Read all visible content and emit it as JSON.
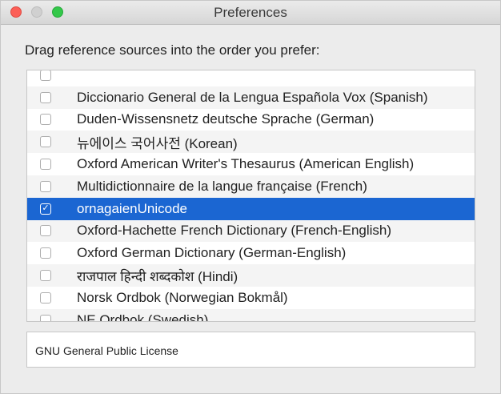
{
  "window": {
    "title": "Preferences"
  },
  "instruction": "Drag reference sources into the order you prefer:",
  "sources": [
    {
      "label": "",
      "checked": false
    },
    {
      "label": "Diccionario General de la Lengua Española Vox (Spanish)",
      "checked": false
    },
    {
      "label": "Duden-Wissensnetz deutsche Sprache (German)",
      "checked": false
    },
    {
      "label": "뉴에이스 국어사전 (Korean)",
      "checked": false
    },
    {
      "label": "Oxford American Writer's Thesaurus (American English)",
      "checked": false
    },
    {
      "label": "Multidictionnaire de la langue française (French)",
      "checked": false
    },
    {
      "label": "ornagaienUnicode",
      "checked": true,
      "selected": true
    },
    {
      "label": "Oxford-Hachette French Dictionary (French-English)",
      "checked": false
    },
    {
      "label": "Oxford German Dictionary (German-English)",
      "checked": false
    },
    {
      "label": "राजपाल हिन्दी शब्दकोश (Hindi)",
      "checked": false
    },
    {
      "label": "Norsk Ordbok (Norwegian Bokmål)",
      "checked": false
    },
    {
      "label": "NE Ordbok (Swedish)",
      "checked": false
    }
  ],
  "license": "GNU General Public License",
  "colors": {
    "selection": "#1b66d2",
    "close": "#fc5f57",
    "zoom": "#34c84a"
  },
  "icons": {
    "check": "✓"
  }
}
